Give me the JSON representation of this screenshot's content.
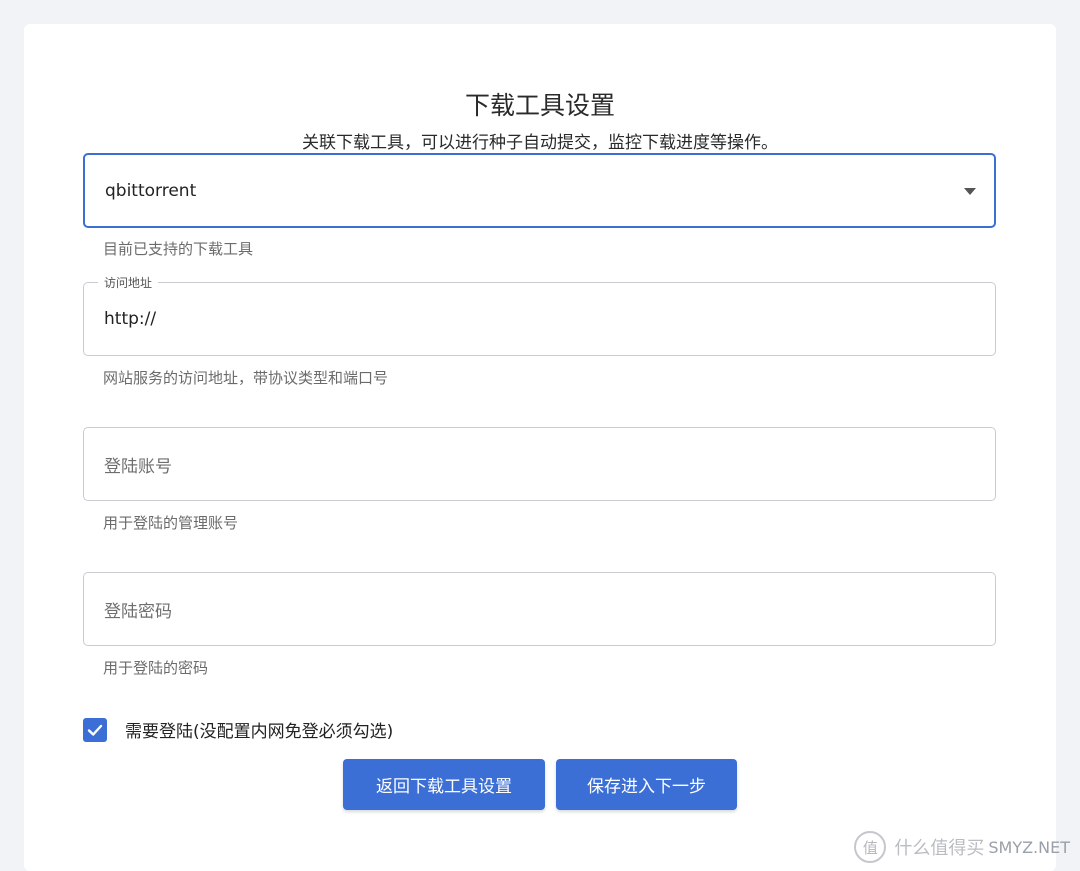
{
  "header": {
    "title": "下载工具设置",
    "subtitle": "关联下载工具，可以进行种子自动提交，监控下载进度等操作。"
  },
  "downloader": {
    "selected": "qbittorrent",
    "helper": "目前已支持的下载工具"
  },
  "address": {
    "label": "访问地址",
    "value": "http://",
    "helper": "网站服务的访问地址，带协议类型和端口号"
  },
  "username": {
    "placeholder": "登陆账号",
    "helper": "用于登陆的管理账号"
  },
  "password": {
    "placeholder": "登陆密码",
    "helper": "用于登陆的密码"
  },
  "login_required": {
    "checked": true,
    "label": "需要登陆(没配置内网免登必须勾选)"
  },
  "actions": {
    "back_label": "返回下载工具设置",
    "next_label": "保存进入下一步"
  },
  "watermark": {
    "logo_char": "值",
    "text": "什么值得买",
    "brand": "SMYZ.NET"
  },
  "colors": {
    "accent": "#3b6fd6",
    "background": "#f2f3f6"
  }
}
